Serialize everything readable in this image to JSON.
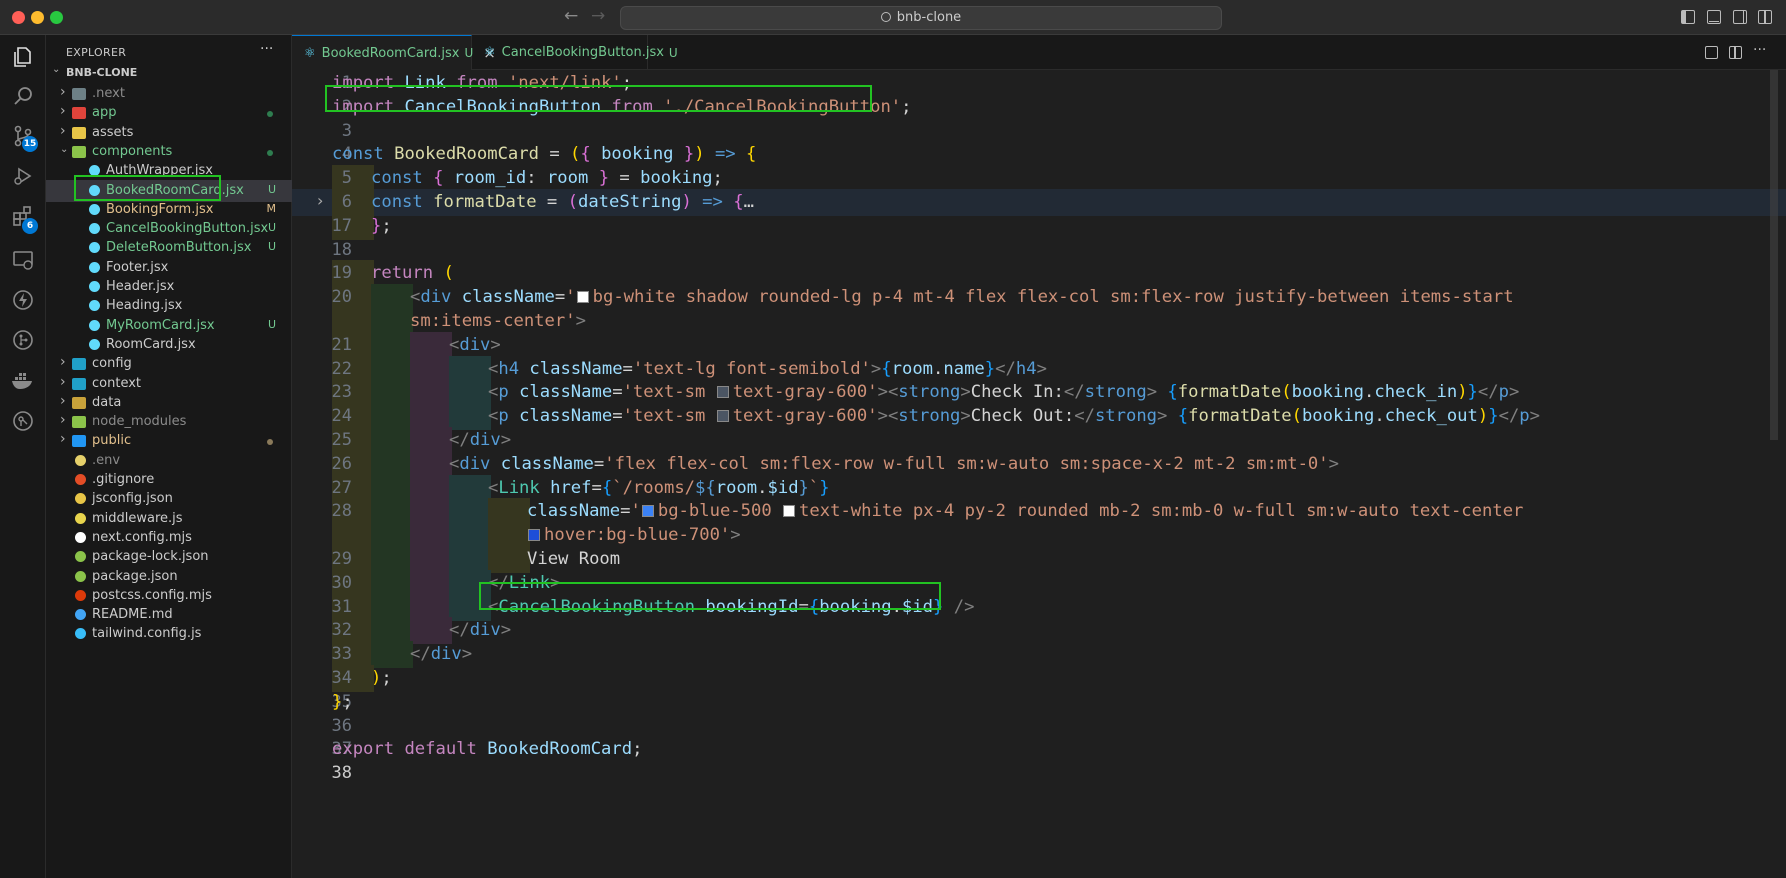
{
  "window": {
    "title": "bnb-clone"
  },
  "colors": {
    "accent": "#0078d4",
    "highlight_box": "#22c222",
    "modified": "#e2c08d",
    "untracked": "#73c991"
  },
  "activity_bar": {
    "items": [
      {
        "name": "explorer-icon"
      },
      {
        "name": "search-icon"
      },
      {
        "name": "source-control-icon",
        "badge": "15"
      },
      {
        "name": "run-debug-icon"
      },
      {
        "name": "extensions-icon",
        "badge": "6"
      },
      {
        "name": "remote-explorer-icon"
      },
      {
        "name": "lightning-icon"
      },
      {
        "name": "git-graph-icon"
      },
      {
        "name": "docker-icon"
      },
      {
        "name": "git-lens-icon"
      }
    ]
  },
  "sidebar": {
    "title": "EXPLORER",
    "more": "···",
    "root": "BNB-CLONE",
    "items": [
      {
        "label": ".next",
        "type": "folder",
        "indent": 1,
        "icon_color": "#6d8086",
        "label_color": "#8b8b8b"
      },
      {
        "label": "app",
        "type": "folder",
        "indent": 1,
        "icon_color": "#e0443b",
        "label_color": "#73c991",
        "dot": "#2e7d4f"
      },
      {
        "label": "assets",
        "type": "folder",
        "indent": 1,
        "icon_color": "#e8c547",
        "label_color": "#cccccc"
      },
      {
        "label": "components",
        "type": "folder-open",
        "indent": 1,
        "icon_color": "#8bc34a",
        "label_color": "#73c991",
        "dot": "#2e7d4f"
      },
      {
        "label": "AuthWrapper.jsx",
        "type": "file",
        "indent": 2,
        "icon_color": "#61dafb",
        "label_color": "#cccccc"
      },
      {
        "label": "BookedRoomCard.jsx",
        "type": "file",
        "indent": 2,
        "icon_color": "#61dafb",
        "label_color": "#73c991",
        "status": "U",
        "selected": true
      },
      {
        "label": "BookingForm.jsx",
        "type": "file",
        "indent": 2,
        "icon_color": "#61dafb",
        "label_color": "#e2c08d",
        "status": "M"
      },
      {
        "label": "CancelBookingButton.jsx",
        "type": "file",
        "indent": 2,
        "icon_color": "#61dafb",
        "label_color": "#73c991",
        "status": "U"
      },
      {
        "label": "DeleteRoomButton.jsx",
        "type": "file",
        "indent": 2,
        "icon_color": "#61dafb",
        "label_color": "#73c991",
        "status": "U"
      },
      {
        "label": "Footer.jsx",
        "type": "file",
        "indent": 2,
        "icon_color": "#61dafb",
        "label_color": "#cccccc"
      },
      {
        "label": "Header.jsx",
        "type": "file",
        "indent": 2,
        "icon_color": "#61dafb",
        "label_color": "#cccccc"
      },
      {
        "label": "Heading.jsx",
        "type": "file",
        "indent": 2,
        "icon_color": "#61dafb",
        "label_color": "#cccccc"
      },
      {
        "label": "MyRoomCard.jsx",
        "type": "file",
        "indent": 2,
        "icon_color": "#61dafb",
        "label_color": "#73c991",
        "status": "U"
      },
      {
        "label": "RoomCard.jsx",
        "type": "file",
        "indent": 2,
        "icon_color": "#61dafb",
        "label_color": "#cccccc"
      },
      {
        "label": "config",
        "type": "folder",
        "indent": 1,
        "icon_color": "#20a0c8",
        "label_color": "#cccccc"
      },
      {
        "label": "context",
        "type": "folder",
        "indent": 1,
        "icon_color": "#20a0c8",
        "label_color": "#cccccc"
      },
      {
        "label": "data",
        "type": "folder",
        "indent": 1,
        "icon_color": "#c8a23a",
        "label_color": "#cccccc"
      },
      {
        "label": "node_modules",
        "type": "folder",
        "indent": 1,
        "icon_color": "#8bc34a",
        "label_color": "#8b8b8b"
      },
      {
        "label": "public",
        "type": "folder",
        "indent": 1,
        "icon_color": "#2196f3",
        "label_color": "#e2c08d",
        "dot": "#8a7a5a"
      },
      {
        "label": ".env",
        "type": "file",
        "indent": 1,
        "icon_color": "#e6d06a",
        "label_color": "#8b8b8b"
      },
      {
        "label": ".gitignore",
        "type": "file",
        "indent": 1,
        "icon_color": "#e44d26",
        "label_color": "#cccccc"
      },
      {
        "label": "jsconfig.json",
        "type": "file",
        "indent": 1,
        "icon_color": "#e8c547",
        "label_color": "#cccccc"
      },
      {
        "label": "middleware.js",
        "type": "file",
        "indent": 1,
        "icon_color": "#e8d44d",
        "label_color": "#cccccc"
      },
      {
        "label": "next.config.mjs",
        "type": "file",
        "indent": 1,
        "icon_color": "#ffffff",
        "label_color": "#cccccc"
      },
      {
        "label": "package-lock.json",
        "type": "file",
        "indent": 1,
        "icon_color": "#8bc34a",
        "label_color": "#cccccc"
      },
      {
        "label": "package.json",
        "type": "file",
        "indent": 1,
        "icon_color": "#8bc34a",
        "label_color": "#cccccc"
      },
      {
        "label": "postcss.config.mjs",
        "type": "file",
        "indent": 1,
        "icon_color": "#dd3a0a",
        "label_color": "#cccccc"
      },
      {
        "label": "README.md",
        "type": "file",
        "indent": 1,
        "icon_color": "#42a5f5",
        "label_color": "#cccccc"
      },
      {
        "label": "tailwind.config.js",
        "type": "file",
        "indent": 1,
        "icon_color": "#38bdf8",
        "label_color": "#cccccc"
      }
    ]
  },
  "tabs": [
    {
      "label": "BookedRoomCard.jsx",
      "status": "U",
      "active": true,
      "close": "×"
    },
    {
      "label": "CancelBookingButton.jsx",
      "status": "U",
      "active": false
    }
  ],
  "editor": {
    "lines": [
      {
        "n": "1",
        "segs": [
          [
            "k",
            "import "
          ],
          [
            "v",
            "Link"
          ],
          [
            "k",
            " from "
          ],
          [
            "s",
            "'next/link'"
          ],
          [
            "tx",
            ";"
          ]
        ]
      },
      {
        "n": "2",
        "segs": [
          [
            "k",
            "import "
          ],
          [
            "v",
            "CancelBookingButton"
          ],
          [
            "k",
            " from "
          ],
          [
            "s",
            "'./CancelBookingButton'"
          ],
          [
            "tx",
            ";"
          ]
        ]
      },
      {
        "n": "3",
        "segs": []
      },
      {
        "n": "4",
        "segs": [
          [
            "kb",
            "const "
          ],
          [
            "f",
            "BookedRoomCard"
          ],
          [
            "tx",
            " = "
          ],
          [
            "p",
            "("
          ],
          [
            "pp",
            "{ "
          ],
          [
            "v",
            "booking "
          ],
          [
            "pp",
            "}"
          ],
          [
            "p",
            ")"
          ],
          [
            "kb",
            " => "
          ],
          [
            "p",
            "{"
          ]
        ]
      },
      {
        "n": "5",
        "segs": [
          [
            "kb",
            "const "
          ],
          [
            "pp",
            "{ "
          ],
          [
            "v",
            "room_id"
          ],
          [
            "tx",
            ": "
          ],
          [
            "v",
            "room "
          ],
          [
            "pp",
            "}"
          ],
          [
            "tx",
            " = "
          ],
          [
            "v",
            "booking"
          ],
          [
            "tx",
            ";"
          ]
        ]
      },
      {
        "n": "6",
        "segs": [
          [
            "kb",
            "const "
          ],
          [
            "f",
            "formatDate"
          ],
          [
            "tx",
            " = "
          ],
          [
            "pp",
            "("
          ],
          [
            "v",
            "dateString"
          ],
          [
            "pp",
            ")"
          ],
          [
            "kb",
            " => "
          ],
          [
            "pp",
            "{"
          ],
          [
            "tx",
            "…"
          ]
        ],
        "folded": true,
        "fold_marker": "›"
      },
      {
        "n": "17",
        "segs": [
          [
            "pp",
            "}"
          ],
          [
            "tx",
            ";"
          ]
        ]
      },
      {
        "n": "18",
        "segs": []
      },
      {
        "n": "19",
        "segs": [
          [
            "k",
            "return "
          ],
          [
            "p",
            "("
          ]
        ]
      },
      {
        "n": "20",
        "segs": [
          [
            "tg",
            "<"
          ],
          [
            "kb",
            "div "
          ],
          [
            "a",
            "className"
          ],
          [
            "tx",
            "="
          ],
          [
            "s",
            "'"
          ],
          [
            "sw",
            "#ffffff"
          ],
          [
            "s",
            "bg-white shadow rounded-lg p-4 mt-4 flex flex-col sm:flex-row justify-between items-start"
          ]
        ]
      },
      {
        "n": "",
        "segs": [
          [
            "s",
            "sm:items-center'"
          ],
          [
            "tg",
            ">"
          ]
        ]
      },
      {
        "n": "21",
        "segs": [
          [
            "tg",
            "<"
          ],
          [
            "kb",
            "div"
          ],
          [
            "tg",
            ">"
          ]
        ]
      },
      {
        "n": "22",
        "segs": [
          [
            "tg",
            "<"
          ],
          [
            "kb",
            "h4 "
          ],
          [
            "a",
            "className"
          ],
          [
            "tx",
            "="
          ],
          [
            "s",
            "'text-lg font-semibold'"
          ],
          [
            "tg",
            ">"
          ],
          [
            "pb",
            "{"
          ],
          [
            "v",
            "room"
          ],
          [
            "tx",
            "."
          ],
          [
            "v",
            "name"
          ],
          [
            "pb",
            "}"
          ],
          [
            "tg",
            "</"
          ],
          [
            "kb",
            "h4"
          ],
          [
            "tg",
            ">"
          ]
        ]
      },
      {
        "n": "23",
        "segs": [
          [
            "tg",
            "<"
          ],
          [
            "kb",
            "p "
          ],
          [
            "a",
            "className"
          ],
          [
            "tx",
            "="
          ],
          [
            "s",
            "'text-sm "
          ],
          [
            "sw",
            "#4b5563"
          ],
          [
            "s",
            "text-gray-600'"
          ],
          [
            "tg",
            ">"
          ],
          [
            "tg",
            "<"
          ],
          [
            "kb",
            "strong"
          ],
          [
            "tg",
            ">"
          ],
          [
            "tx",
            "Check In:"
          ],
          [
            "tg",
            "</"
          ],
          [
            "kb",
            "strong"
          ],
          [
            "tg",
            "> "
          ],
          [
            "pb",
            "{"
          ],
          [
            "f",
            "formatDate"
          ],
          [
            "p",
            "("
          ],
          [
            "v",
            "booking"
          ],
          [
            "tx",
            "."
          ],
          [
            "v",
            "check_in"
          ],
          [
            "p",
            ")"
          ],
          [
            "pb",
            "}"
          ],
          [
            "tg",
            "</"
          ],
          [
            "kb",
            "p"
          ],
          [
            "tg",
            ">"
          ]
        ]
      },
      {
        "n": "24",
        "segs": [
          [
            "tg",
            "<"
          ],
          [
            "kb",
            "p "
          ],
          [
            "a",
            "className"
          ],
          [
            "tx",
            "="
          ],
          [
            "s",
            "'text-sm "
          ],
          [
            "sw",
            "#4b5563"
          ],
          [
            "s",
            "text-gray-600'"
          ],
          [
            "tg",
            ">"
          ],
          [
            "tg",
            "<"
          ],
          [
            "kb",
            "strong"
          ],
          [
            "tg",
            ">"
          ],
          [
            "tx",
            "Check Out:"
          ],
          [
            "tg",
            "</"
          ],
          [
            "kb",
            "strong"
          ],
          [
            "tg",
            "> "
          ],
          [
            "pb",
            "{"
          ],
          [
            "f",
            "formatDate"
          ],
          [
            "p",
            "("
          ],
          [
            "v",
            "booking"
          ],
          [
            "tx",
            "."
          ],
          [
            "v",
            "check_out"
          ],
          [
            "p",
            ")"
          ],
          [
            "pb",
            "}"
          ],
          [
            "tg",
            "</"
          ],
          [
            "kb",
            "p"
          ],
          [
            "tg",
            ">"
          ]
        ]
      },
      {
        "n": "25",
        "segs": [
          [
            "tg",
            "</"
          ],
          [
            "kb",
            "div"
          ],
          [
            "tg",
            ">"
          ]
        ]
      },
      {
        "n": "26",
        "segs": [
          [
            "tg",
            "<"
          ],
          [
            "kb",
            "div "
          ],
          [
            "a",
            "className"
          ],
          [
            "tx",
            "="
          ],
          [
            "s",
            "'flex flex-col sm:flex-row w-full sm:w-auto sm:space-x-2 mt-2 sm:mt-0'"
          ],
          [
            "tg",
            ">"
          ]
        ]
      },
      {
        "n": "27",
        "segs": [
          [
            "tg",
            "<"
          ],
          [
            "t",
            "Link "
          ],
          [
            "a",
            "href"
          ],
          [
            "tx",
            "="
          ],
          [
            "pb",
            "{"
          ],
          [
            "s",
            "`/rooms/"
          ],
          [
            "kb",
            "${"
          ],
          [
            "v",
            "room"
          ],
          [
            "tx",
            "."
          ],
          [
            "v",
            "$id"
          ],
          [
            "kb",
            "}"
          ],
          [
            "s",
            "`"
          ],
          [
            "pb",
            "}"
          ]
        ]
      },
      {
        "n": "28",
        "segs": [
          [
            "a",
            "className"
          ],
          [
            "tx",
            "="
          ],
          [
            "s",
            "'"
          ],
          [
            "sw",
            "#3b82f6"
          ],
          [
            "s",
            "bg-blue-500 "
          ],
          [
            "sw",
            "#ffffff"
          ],
          [
            "s",
            "text-white px-4 py-2 rounded mb-2 sm:mb-0 w-full sm:w-auto text-center"
          ]
        ]
      },
      {
        "n": "",
        "segs": [
          [
            "sw",
            "#1d4ed8"
          ],
          [
            "s",
            "hover:bg-blue-700'"
          ],
          [
            "tg",
            ">"
          ]
        ]
      },
      {
        "n": "29",
        "segs": [
          [
            "tx",
            "View Room"
          ]
        ]
      },
      {
        "n": "30",
        "segs": [
          [
            "tg",
            "</"
          ],
          [
            "t",
            "Link"
          ],
          [
            "tg",
            ">"
          ]
        ]
      },
      {
        "n": "31",
        "segs": [
          [
            "tg",
            "<"
          ],
          [
            "t",
            "CancelBookingButton "
          ],
          [
            "a",
            "bookingId"
          ],
          [
            "tx",
            "="
          ],
          [
            "pb",
            "{"
          ],
          [
            "v",
            "booking"
          ],
          [
            "tx",
            "."
          ],
          [
            "v",
            "$id"
          ],
          [
            "pb",
            "}"
          ],
          [
            "tg",
            " />"
          ]
        ]
      },
      {
        "n": "32",
        "segs": [
          [
            "tg",
            "</"
          ],
          [
            "kb",
            "div"
          ],
          [
            "tg",
            ">"
          ]
        ]
      },
      {
        "n": "33",
        "segs": [
          [
            "tg",
            "</"
          ],
          [
            "kb",
            "div"
          ],
          [
            "tg",
            ">"
          ]
        ]
      },
      {
        "n": "34",
        "segs": [
          [
            "p",
            ")"
          ],
          [
            "tx",
            ";"
          ]
        ]
      },
      {
        "n": "35",
        "segs": [
          [
            "p",
            "}"
          ],
          [
            "tx",
            ";"
          ]
        ]
      },
      {
        "n": "36",
        "segs": []
      },
      {
        "n": "37",
        "segs": [
          [
            "k",
            "export "
          ],
          [
            "k",
            "default "
          ],
          [
            "v",
            "BookedRoomCard"
          ],
          [
            "tx",
            ";"
          ]
        ]
      },
      {
        "n": "38",
        "segs": []
      }
    ]
  }
}
